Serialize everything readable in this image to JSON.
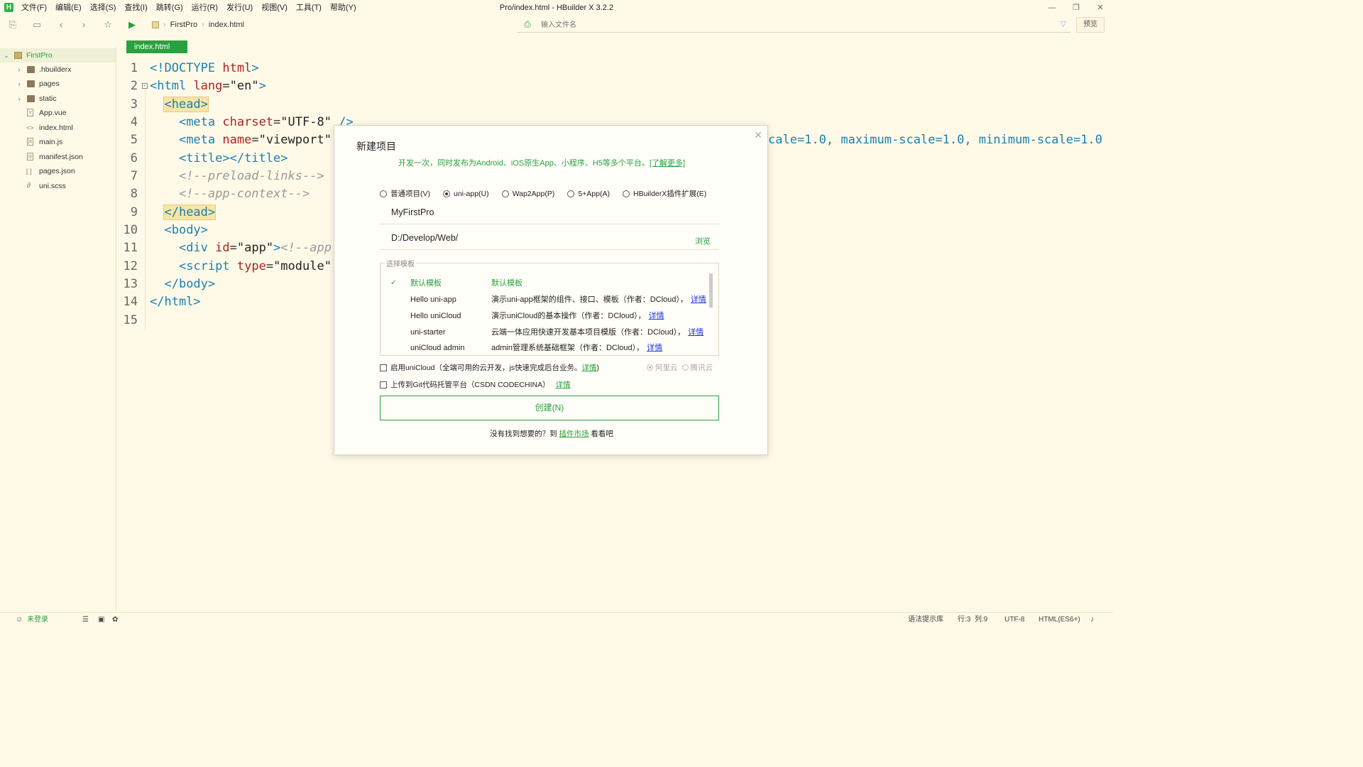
{
  "app": {
    "logo": "H",
    "window_title": "Pro/index.html - HBuilder X 3.2.2"
  },
  "menu": [
    "文件(F)",
    "编辑(E)",
    "选择(S)",
    "查找(I)",
    "跳转(G)",
    "运行(R)",
    "发行(U)",
    "视图(V)",
    "工具(T)",
    "帮助(Y)"
  ],
  "window_controls": {
    "minimize": "—",
    "restore": "❐",
    "close": "✕"
  },
  "toolbar": {
    "breadcrumb": [
      "FirstPro",
      "index.html"
    ],
    "file_search_placeholder": "输入文件名",
    "preview_label": "预览",
    "icons": [
      "new-file-icon",
      "save-icon",
      "back-icon",
      "forward-icon",
      "star-icon",
      "run-icon"
    ]
  },
  "sidebar": {
    "project": "FirstPro",
    "items": [
      {
        "label": ".hbuilderx",
        "type": "folder"
      },
      {
        "label": "pages",
        "type": "folder"
      },
      {
        "label": "static",
        "type": "folder"
      },
      {
        "label": "App.vue",
        "type": "file"
      },
      {
        "label": "index.html",
        "type": "file"
      },
      {
        "label": "main.js",
        "type": "file"
      },
      {
        "label": "manifest.json",
        "type": "file"
      },
      {
        "label": "pages.json",
        "type": "file"
      },
      {
        "label": "uni.scss",
        "type": "file"
      }
    ]
  },
  "editor": {
    "tab": "index.html",
    "overflow_text": "cale=1.0, maximum-scale=1.0, minimum-scale=1.0"
  },
  "dialog": {
    "title": "新建项目",
    "subtitle": "开发一次，同时发布为Android、iOS原生App、小程序、H5等多个平台。",
    "learn_more": "[了解更多]",
    "project_types": [
      {
        "label": "普通项目(V)",
        "selected": false
      },
      {
        "label": "uni-app(U)",
        "selected": true
      },
      {
        "label": "Wap2App(P)",
        "selected": false
      },
      {
        "label": "5+App(A)",
        "selected": false
      },
      {
        "label": "HBuilderX插件扩展(E)",
        "selected": false
      }
    ],
    "project_name": "MyFirstPro",
    "location": "D:/Develop/Web/",
    "browse": "浏览",
    "template_legend": "选择模板",
    "templates": [
      {
        "name": "默认模板",
        "desc": "默认模板",
        "detail": "",
        "selected": true
      },
      {
        "name": "Hello uni-app",
        "desc": "演示uni-app框架的组件、接口、模板（作者：DCloud），",
        "detail": "详情",
        "selected": false
      },
      {
        "name": "Hello uniCloud",
        "desc": "演示uniCloud的基本操作（作者：DCloud），",
        "detail": "详情",
        "selected": false
      },
      {
        "name": "uni-starter",
        "desc": "云端一体应用快速开发基本项目模版（作者：DCloud），",
        "detail": "详情",
        "selected": false
      },
      {
        "name": "uniCloud admin",
        "desc": "admin管理系统基础框架（作者：DCloud），",
        "detail": "详情",
        "selected": false
      }
    ],
    "unicloud_label": "启用uniCloud（全端可用的云开发，js快速完成后台业务。",
    "unicloud_detail": "详情",
    "unicloud_close": ")",
    "cloud_providers": [
      {
        "label": "阿里云",
        "selected": true
      },
      {
        "label": "腾讯云",
        "selected": false
      }
    ],
    "git_label": "上传到Git代码托管平台（CSDN CODECHINA）",
    "git_detail": "详情",
    "create_button": "创建(N)",
    "footer_prefix": "没有找到想要的？到",
    "footer_link": "插件市场",
    "footer_suffix": "看看吧",
    "close": "✕"
  },
  "statusbar": {
    "login": "未登录",
    "syntax_hint": "语法提示库",
    "position": "行:3  列:9",
    "encoding": "UTF-8",
    "language": "HTML(ES6+)"
  },
  "colors": {
    "accent": "#2aa13f",
    "background": "#fffae8",
    "tag": "#1a7fb0",
    "attribute": "#b22020",
    "link": "#1a35d8"
  }
}
